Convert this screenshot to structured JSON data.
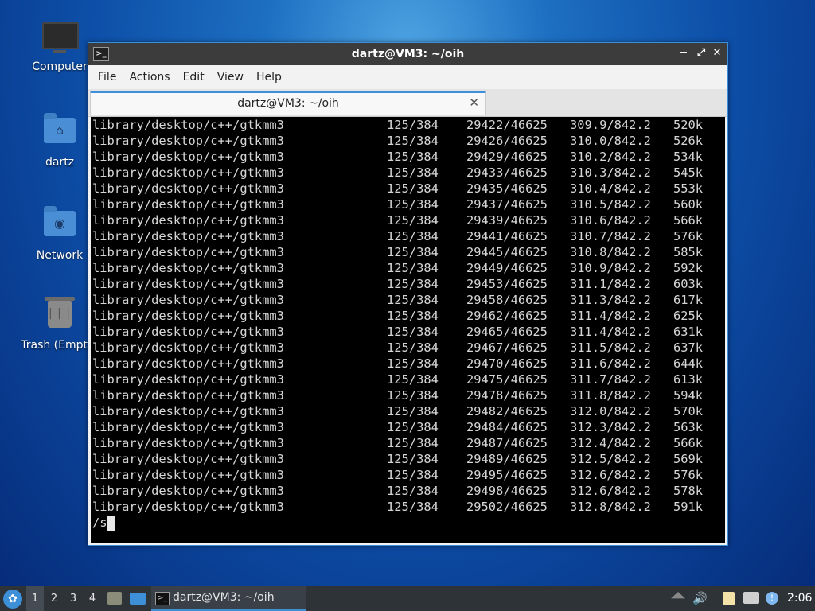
{
  "desktop": {
    "icons": [
      {
        "label": "Computer",
        "icon": "computer-icon"
      },
      {
        "label": "dartz",
        "icon": "home-folder-icon"
      },
      {
        "label": "Network",
        "icon": "network-folder-icon"
      },
      {
        "label": "Trash (Empty)",
        "icon": "trash-icon"
      }
    ]
  },
  "window": {
    "title": "dartz@VM3: ~/oih",
    "controls": {
      "minimize": "−",
      "maximize": "⤢",
      "close": "✕"
    },
    "menu": [
      "File",
      "Actions",
      "Edit",
      "View",
      "Help"
    ],
    "tab": {
      "label": "dartz@VM3: ~/oih",
      "close": "✕"
    }
  },
  "terminal": {
    "rows": [
      [
        "library/desktop/c++/gtkmm3",
        "125/384",
        "29422/46625",
        "309.9/842.2",
        "520k"
      ],
      [
        "library/desktop/c++/gtkmm3",
        "125/384",
        "29426/46625",
        "310.0/842.2",
        "526k"
      ],
      [
        "library/desktop/c++/gtkmm3",
        "125/384",
        "29429/46625",
        "310.2/842.2",
        "534k"
      ],
      [
        "library/desktop/c++/gtkmm3",
        "125/384",
        "29433/46625",
        "310.3/842.2",
        "545k"
      ],
      [
        "library/desktop/c++/gtkmm3",
        "125/384",
        "29435/46625",
        "310.4/842.2",
        "553k"
      ],
      [
        "library/desktop/c++/gtkmm3",
        "125/384",
        "29437/46625",
        "310.5/842.2",
        "560k"
      ],
      [
        "library/desktop/c++/gtkmm3",
        "125/384",
        "29439/46625",
        "310.6/842.2",
        "566k"
      ],
      [
        "library/desktop/c++/gtkmm3",
        "125/384",
        "29441/46625",
        "310.7/842.2",
        "576k"
      ],
      [
        "library/desktop/c++/gtkmm3",
        "125/384",
        "29445/46625",
        "310.8/842.2",
        "585k"
      ],
      [
        "library/desktop/c++/gtkmm3",
        "125/384",
        "29449/46625",
        "310.9/842.2",
        "592k"
      ],
      [
        "library/desktop/c++/gtkmm3",
        "125/384",
        "29453/46625",
        "311.1/842.2",
        "603k"
      ],
      [
        "library/desktop/c++/gtkmm3",
        "125/384",
        "29458/46625",
        "311.3/842.2",
        "617k"
      ],
      [
        "library/desktop/c++/gtkmm3",
        "125/384",
        "29462/46625",
        "311.4/842.2",
        "625k"
      ],
      [
        "library/desktop/c++/gtkmm3",
        "125/384",
        "29465/46625",
        "311.4/842.2",
        "631k"
      ],
      [
        "library/desktop/c++/gtkmm3",
        "125/384",
        "29467/46625",
        "311.5/842.2",
        "637k"
      ],
      [
        "library/desktop/c++/gtkmm3",
        "125/384",
        "29470/46625",
        "311.6/842.2",
        "644k"
      ],
      [
        "library/desktop/c++/gtkmm3",
        "125/384",
        "29475/46625",
        "311.7/842.2",
        "613k"
      ],
      [
        "library/desktop/c++/gtkmm3",
        "125/384",
        "29478/46625",
        "311.8/842.2",
        "594k"
      ],
      [
        "library/desktop/c++/gtkmm3",
        "125/384",
        "29482/46625",
        "312.0/842.2",
        "570k"
      ],
      [
        "library/desktop/c++/gtkmm3",
        "125/384",
        "29484/46625",
        "312.3/842.2",
        "563k"
      ],
      [
        "library/desktop/c++/gtkmm3",
        "125/384",
        "29487/46625",
        "312.4/842.2",
        "566k"
      ],
      [
        "library/desktop/c++/gtkmm3",
        "125/384",
        "29489/46625",
        "312.5/842.2",
        "569k"
      ],
      [
        "library/desktop/c++/gtkmm3",
        "125/384",
        "29495/46625",
        "312.6/842.2",
        "576k"
      ],
      [
        "library/desktop/c++/gtkmm3",
        "125/384",
        "29498/46625",
        "312.6/842.2",
        "578k"
      ],
      [
        "library/desktop/c++/gtkmm3",
        "125/384",
        "29502/46625",
        "312.8/842.2",
        "591k"
      ]
    ],
    "prompt": "/s"
  },
  "taskbar": {
    "start_icon": "start-menu-icon",
    "workspaces": [
      "1",
      "2",
      "3",
      "4"
    ],
    "active_workspace": "1",
    "task": {
      "label": "dartz@VM3: ~/oih",
      "icon": "terminal-icon"
    },
    "tray_icons": [
      "eject-icon",
      "volume-icon",
      "clipboard-icon",
      "network-icon",
      "notification-icon"
    ],
    "clock": "2:06"
  },
  "colors": {
    "accent": "#3d8fd8",
    "terminal_bg": "#000000",
    "terminal_fg": "#d6d6d6",
    "taskbar": "#2e3338"
  }
}
